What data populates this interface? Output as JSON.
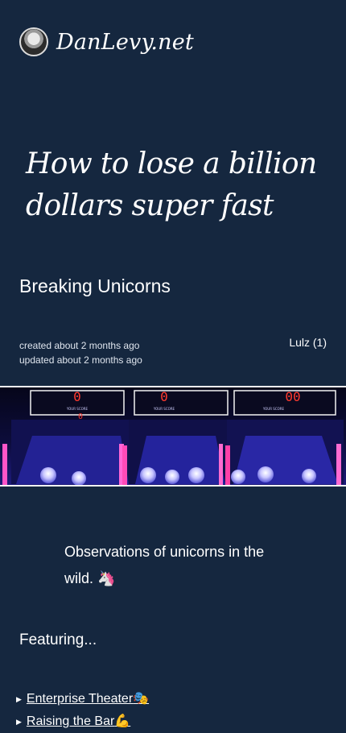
{
  "site": {
    "title": "DanLevy.net"
  },
  "post": {
    "title": "How to lose a billion dollars super fast",
    "subtitle": "Breaking Unicorns",
    "created": "created about 2 months ago",
    "updated": "updated about 2 months ago",
    "tag": "Lulz (1)",
    "lede": "Observations of unicorns in the wild. 🦄",
    "featuring_heading": "Featuring...",
    "featuring_items": [
      {
        "label": "Enterprise Theater",
        "emoji": "🎭"
      },
      {
        "label": "Raising the Bar",
        "emoji": "💪"
      }
    ]
  },
  "hero": {
    "machines": [
      {
        "display": "0",
        "sub": "0",
        "caption": "YOUR SCORE"
      },
      {
        "display": "0",
        "sub": "",
        "caption": "YOUR SCORE"
      },
      {
        "display": "00",
        "sub": "",
        "caption": "YOUR SCORE"
      }
    ]
  }
}
